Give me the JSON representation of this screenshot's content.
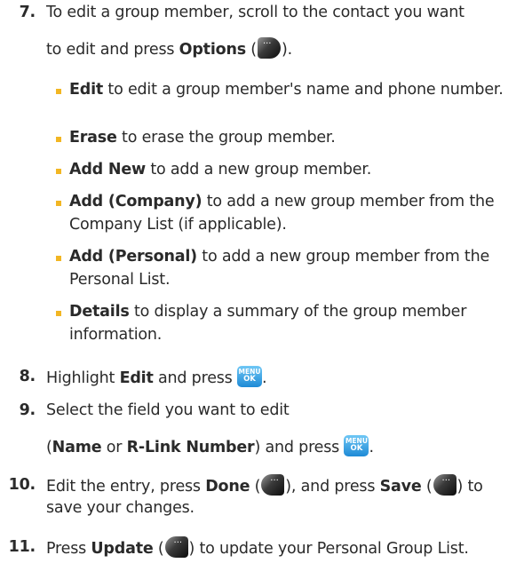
{
  "step7": {
    "num": "7.",
    "l1": "To edit a group member, scroll to the contact you want",
    "l2_pre": "to edit and press ",
    "l2_bold": "Options",
    "l2_open": " (",
    "l2_close": ").",
    "icon": "options-softkey-icon"
  },
  "bullets": [
    {
      "bold": "Edit",
      "text": " to edit a group member's name and phone number."
    },
    {
      "bold": "Erase",
      "text": " to erase the group member."
    },
    {
      "bold": "Add New",
      "text": " to add a new group member."
    },
    {
      "bold": "Add (Company)",
      "text": " to add a new group member from the Company List (if applicable)."
    },
    {
      "bold": "Add (Personal)",
      "text": " to add a new group member from the Personal List."
    },
    {
      "bold": "Details",
      "text": " to display a summary of the group member information."
    }
  ],
  "step8": {
    "num": "8.",
    "pre": "Highlight ",
    "bold": "Edit",
    "mid": " and press ",
    "post": ".",
    "icon": "menu-ok-key-icon"
  },
  "step9": {
    "num": "9.",
    "l1": "Select the field you want to edit",
    "l2_open": "(",
    "l2_b1": "Name",
    "l2_or": " or ",
    "l2_b2": "R-Link Number",
    "l2_mid": ") and press ",
    "l2_post": "."
  },
  "step10": {
    "num": "10.",
    "l1_a": "Edit the entry, press ",
    "l1_b1": "Done",
    "l1_c": " (",
    "l1_d": "), and press ",
    "l1_b2": "Save",
    "l1_e": " (",
    "l1_f": ") to",
    "l2": "save your changes."
  },
  "step11": {
    "num": "11.",
    "a": "Press ",
    "b": "Update",
    "c": " (",
    "d": ") to update your Personal Group List."
  },
  "icon_menu": {
    "line1": "MENU",
    "line2": "OK"
  }
}
